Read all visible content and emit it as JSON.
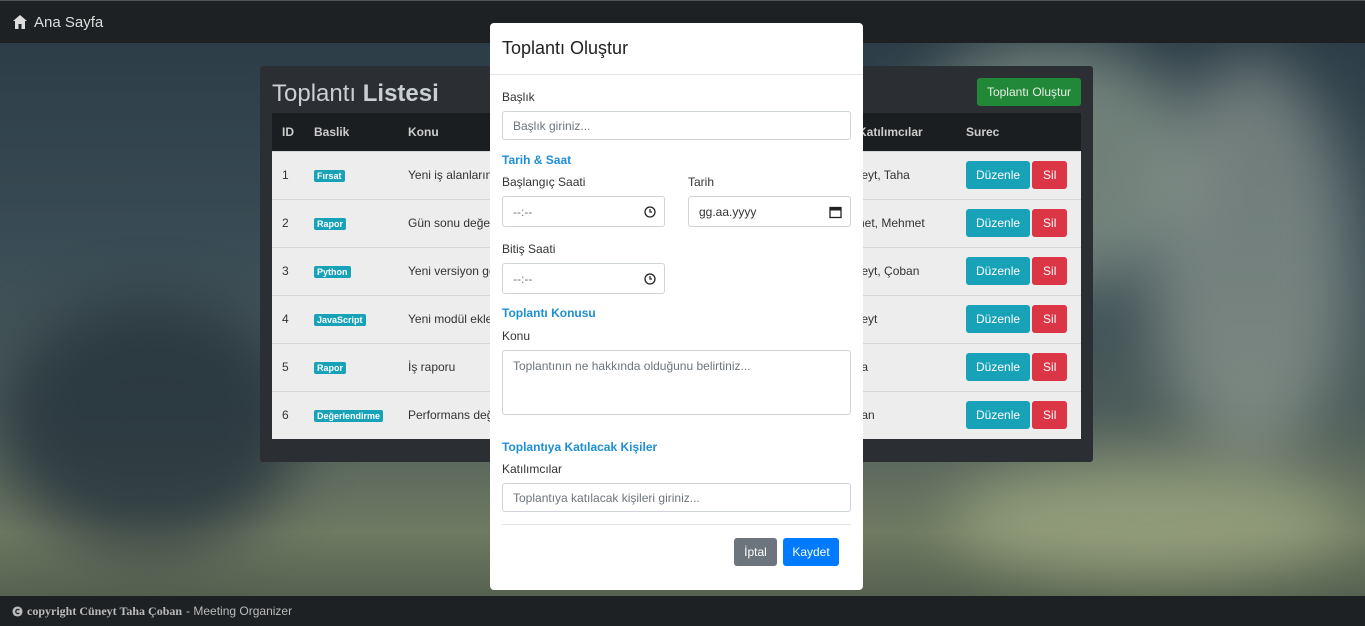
{
  "navbar": {
    "brand": "Ana Sayfa",
    "icon": "home-icon"
  },
  "panel": {
    "title_light": "Toplantı",
    "title_bold": "Listesi",
    "create_button": "Toplantı Oluştur",
    "columns": [
      "ID",
      "Baslik",
      "Konu",
      "Katılımcılar",
      "Surec"
    ],
    "rows": [
      {
        "id": "1",
        "tag": "Fırsat",
        "konu": "Yeni iş alanların",
        "katilimcilar": "üneyt, Taha"
      },
      {
        "id": "2",
        "tag": "Rapor",
        "konu": "Gün sonu değe",
        "katilimcilar": "hmet, Mehmet"
      },
      {
        "id": "3",
        "tag": "Python",
        "konu": "Yeni versiyon ge",
        "katilimcilar": "üneyt, Çoban"
      },
      {
        "id": "4",
        "tag": "JavaScript",
        "konu": "Yeni modül ekle",
        "katilimcilar": "üneyt"
      },
      {
        "id": "5",
        "tag": "Rapor",
        "konu": "İş raporu",
        "katilimcilar": "aha"
      },
      {
        "id": "6",
        "tag": "Değerlendirme",
        "konu": "Performans değ",
        "katilimcilar": "oban"
      }
    ],
    "edit_label": "Düzenle",
    "delete_label": "Sil"
  },
  "modal": {
    "title": "Toplantı Oluştur",
    "baslik_label": "Başlık",
    "baslik_placeholder": "Başlık giriniz...",
    "section_tarih": "Tarih & Saat",
    "start_label": "Başlangıç Saati",
    "start_value": "--:--",
    "date_label": "Tarih",
    "date_value": "gg.aa.yyyy",
    "end_label": "Bitiş Saati",
    "end_value": "--:--",
    "section_konu": "Toplantı Konusu",
    "konu_label": "Konu",
    "konu_placeholder": "Toplantının ne hakkında olduğunu belirtiniz...",
    "section_kisiler": "Toplantıya Katılacak Kişiler",
    "katilimci_label": "Katılımcılar",
    "katilimci_placeholder": "Toplantıya katılacak kişileri giriniz...",
    "cancel": "İptal",
    "save": "Kaydet"
  },
  "footer": {
    "copyright": "copyright Cüneyt Taha Çoban",
    "suffix": "- Meeting Organizer"
  },
  "colors": {
    "info": "#17a2b8",
    "danger": "#dc3545",
    "success": "#218838",
    "primary": "#007bff",
    "secondary": "#6c757d",
    "section": "#1d8fd6"
  }
}
